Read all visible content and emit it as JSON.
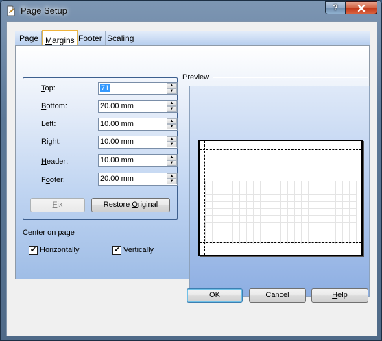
{
  "window": {
    "title": "Page Setup",
    "help_glyph": "?",
    "close_glyph": "x",
    "app_icon": "page-setup-icon"
  },
  "tabs": [
    {
      "label": "Page",
      "active": false
    },
    {
      "label": "Margins",
      "active": true
    },
    {
      "label": "Footer",
      "active": false
    },
    {
      "label": "Scaling",
      "active": false
    }
  ],
  "margins": {
    "top": {
      "label": "Top:",
      "value": "71"
    },
    "bottom": {
      "label": "Bottom:",
      "value": "20.00 mm"
    },
    "left": {
      "label": "Left:",
      "value": "10.00 mm"
    },
    "right": {
      "label": "Right:",
      "value": "10.00 mm"
    },
    "header": {
      "label": "Header:",
      "value": "10.00 mm"
    },
    "footer": {
      "label": "Footer:",
      "value": "20.00 mm"
    }
  },
  "buttons": {
    "fix": "Fix",
    "restore": "Restore Original",
    "ok": "OK",
    "cancel": "Cancel",
    "help": "Help"
  },
  "center_on_page": {
    "title": "Center on page",
    "horizontally": {
      "label": "Horizontally",
      "checked": true
    },
    "vertically": {
      "label": "Vertically",
      "checked": true
    }
  },
  "preview": {
    "title": "Preview"
  },
  "colors": {
    "panel_top": "#ffffff",
    "panel_bottom": "#9fbde6",
    "active_tab_accent": "#f1b43a",
    "close_button": "#c2381a",
    "selection": "#3399ff"
  }
}
